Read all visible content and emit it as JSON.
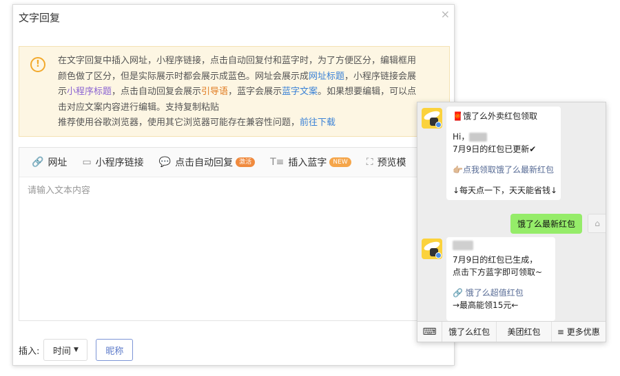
{
  "dialog": {
    "title": "文字回复",
    "close": "×"
  },
  "notice": {
    "icon": "exclamation-circle-icon",
    "line1": "在文字回复中插入网址，小程序链接，点击自动回复付和蓝字时，为了方便区分，编辑框用",
    "line2": "颜色做了区分，但是实际展示时都会展示成蓝色。网址会展示成",
    "line2_link": "网址标题",
    "line2_tail": "，小程序链接会展",
    "line3_a": "示",
    "line3_link1": "小程序标题",
    "line3_b": "，点击自动回复会展示",
    "line3_link2": "引导语",
    "line3_c": "，蓝字会展示",
    "line3_link3": "蓝字文案",
    "line3_d": "。如果想要编辑，可以点",
    "line4": "击对应文案内容进行编辑。支持复制粘贴",
    "line5": "推荐使用谷歌浏览器，使用其它浏览器可能存在兼容性问题，",
    "line5_link": "前往下载",
    "accent": "#f2a92c"
  },
  "toolbar": {
    "url": "网址",
    "miniapp": "小程序链接",
    "autoreply": "点击自动回复",
    "autoreply_badge": "激活",
    "bluetext": "插入蓝字",
    "bluetext_badge": "NEW",
    "preview": "预览模"
  },
  "editor": {
    "placeholder": "请输入文本内容"
  },
  "insert": {
    "label": "插入:",
    "select_value": "时间",
    "nickname": "昵称"
  },
  "phone": {
    "msg1": {
      "title": "饿了么外卖红包领取",
      "hi": "Hi，",
      "updated": "7月9日的红包已更新✔",
      "link": "👉🏼点我领取饿了么最新红包",
      "daily": "↓每天点一下，天天能省钱↓"
    },
    "user_msg": "饿了么最新红包",
    "msg2": {
      "generated": "7月9日的红包已生成，",
      "tip": "点击下方蓝字即可领取~",
      "link": "饿了么超值红包",
      "max": "→最高能领15元←"
    },
    "menu": {
      "keyboard": "keyboard-icon",
      "item1": "饿了么红包",
      "item2": "美团红包",
      "item3": "≡ 更多优惠"
    }
  }
}
